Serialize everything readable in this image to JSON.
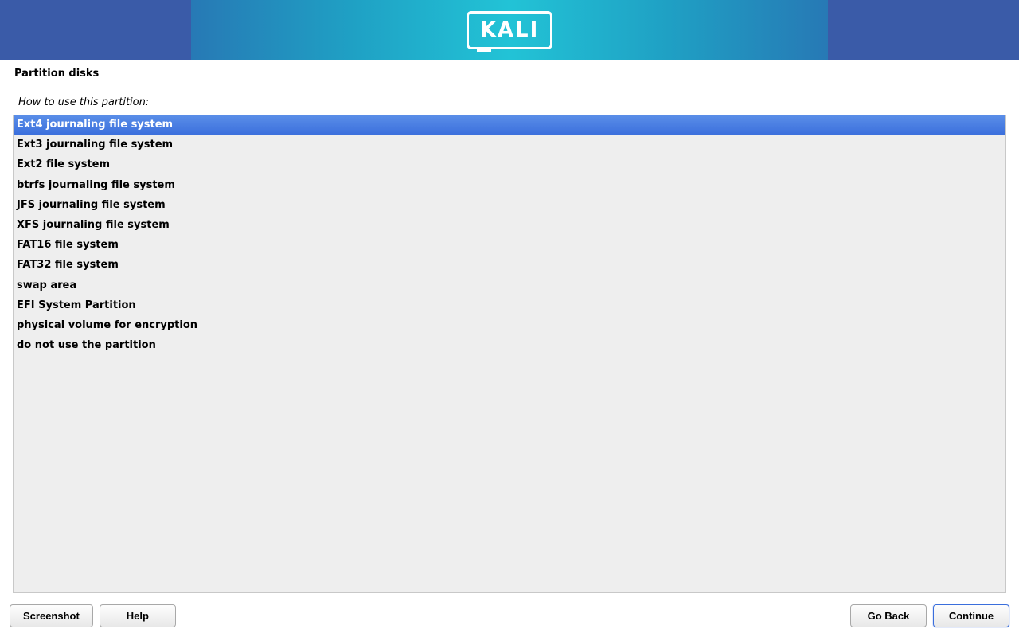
{
  "header": {
    "logo_text": "KALI"
  },
  "page": {
    "title": "Partition disks",
    "prompt": "How to use this partition:"
  },
  "options": [
    {
      "label": "Ext4 journaling file system",
      "selected": true
    },
    {
      "label": "Ext3 journaling file system",
      "selected": false
    },
    {
      "label": "Ext2 file system",
      "selected": false
    },
    {
      "label": "btrfs journaling file system",
      "selected": false
    },
    {
      "label": "JFS journaling file system",
      "selected": false
    },
    {
      "label": "XFS journaling file system",
      "selected": false
    },
    {
      "label": "FAT16 file system",
      "selected": false
    },
    {
      "label": "FAT32 file system",
      "selected": false
    },
    {
      "label": "swap area",
      "selected": false
    },
    {
      "label": "EFI System Partition",
      "selected": false
    },
    {
      "label": "physical volume for encryption",
      "selected": false
    },
    {
      "label": "do not use the partition",
      "selected": false
    }
  ],
  "footer": {
    "screenshot": "Screenshot",
    "help": "Help",
    "go_back": "Go Back",
    "continue": "Continue"
  }
}
